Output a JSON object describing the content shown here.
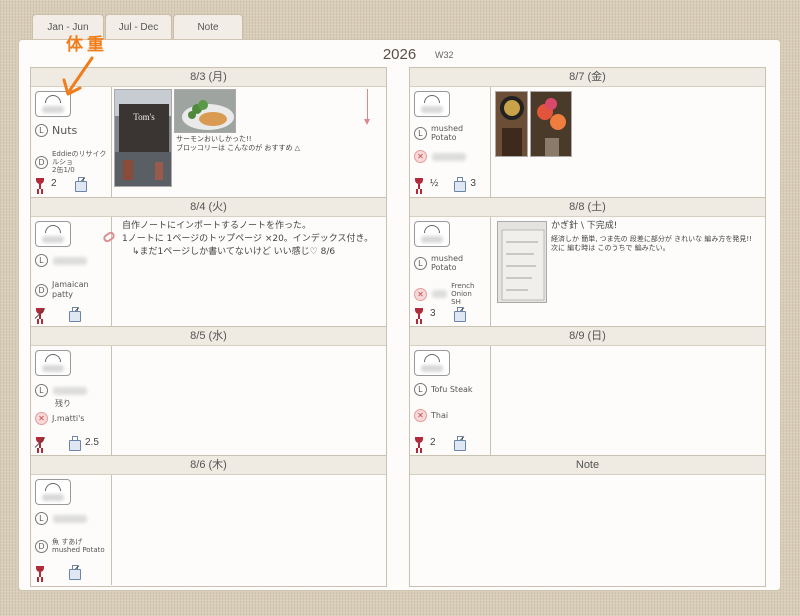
{
  "tabs": [
    {
      "label": "Jan - Jun"
    },
    {
      "label": "Jul - Dec"
    },
    {
      "label": "Note Index"
    }
  ],
  "header": {
    "year": "2026",
    "week": "W32"
  },
  "callout": {
    "text": "体重",
    "color": "#f07d1c"
  },
  "days": {
    "d83": {
      "date": "8/3 (月)",
      "lunch": "Nuts",
      "dinner": "Eddieのリサイクルショ\n2缶1/0",
      "drink": "2",
      "caption": "サーモンおいしかった!!\nブロッコリーは こんなのが おすすめ △"
    },
    "d84": {
      "date": "8/4 (火)",
      "dinner": "Jamaican\npatty",
      "note_lines": [
        "自作ノートにインポートするノートを作った。",
        "1ノートに 1ページのトップページ ×20。インデックス付き。",
        "↳まだ1ページしか書いてないけど いい感じ♡  8/6"
      ]
    },
    "d85": {
      "date": "8/5 (水)",
      "lunch": "残り",
      "dinner": "J.matti's",
      "water": "2.5"
    },
    "d86": {
      "date": "8/6 (木)",
      "dinner": "魚 すあげ\nmushed Potato"
    },
    "d87": {
      "date": "8/7 (金)",
      "lunch": "mushed Potato",
      "drink": "½",
      "water": "3"
    },
    "d88": {
      "date": "8/8 (土)",
      "lunch": "mushed Potato",
      "dinner": "French Onion\nSH",
      "dinner_side": "SH",
      "drink": "3",
      "note_title": "かぎ針 \\ 下完成!",
      "note_body": "経済しか 簡単, つま先の 段差に部分が きれいな 編み方を発見!!\n次に 編む時は このうちで 編みたい。"
    },
    "d89": {
      "date": "8/9 (日)",
      "lunch": "Tofu Steak",
      "dinner": "Thai",
      "drink": "2"
    },
    "note": {
      "date": "Note"
    }
  },
  "colors": {
    "accent": "#f07d1c",
    "wine": "#b02a3a",
    "header_bg": "#efeae2"
  }
}
